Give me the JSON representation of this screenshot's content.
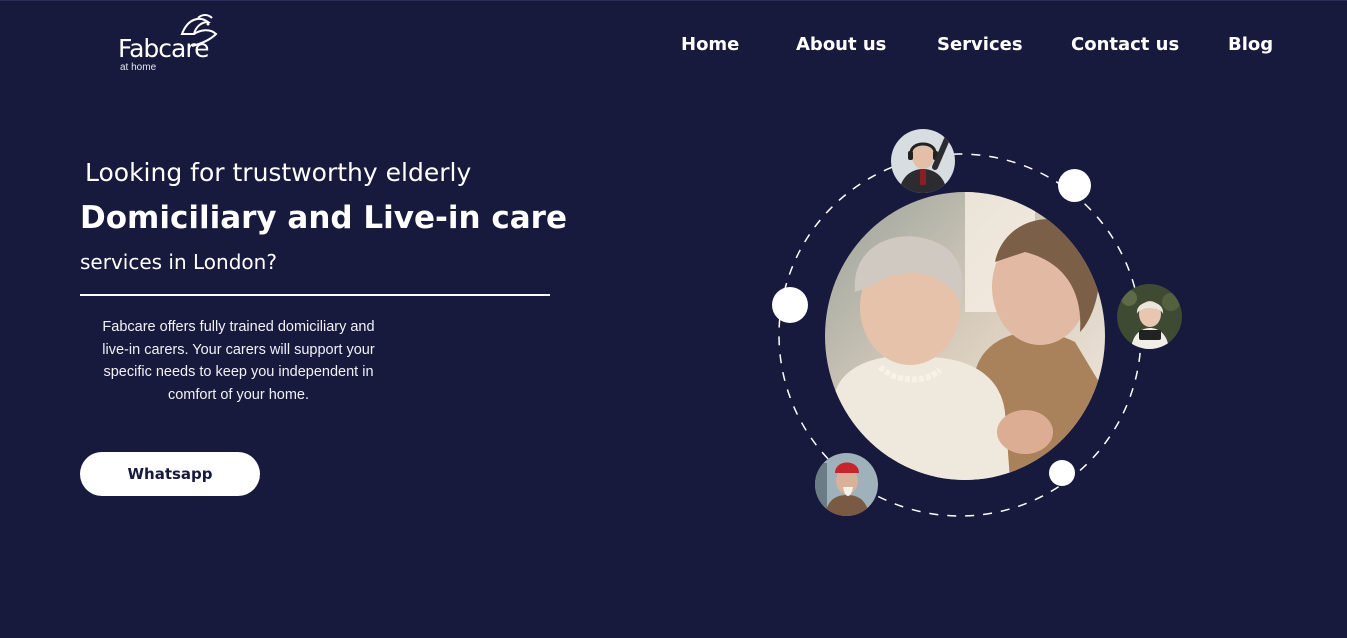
{
  "logo": {
    "wordmark": "Fabcare",
    "tagline": "at home"
  },
  "nav": {
    "items": [
      "Home",
      "About us",
      "Services",
      "Contact us",
      "Blog"
    ]
  },
  "hero": {
    "line1": "Looking for trustworthy elderly",
    "line2": "Domiciliary and Live-in care",
    "line3": "services in London?",
    "description": "Fabcare offers fully trained domiciliary and live-in carers. Your carers will support your specific needs to keep you independent in comfort of your home.",
    "cta_label": "Whatsapp"
  },
  "colors": {
    "background": "#17193d",
    "text": "#ffffff",
    "button_text": "#17193d"
  },
  "icons": {
    "logo_mark": "bird-icon"
  }
}
